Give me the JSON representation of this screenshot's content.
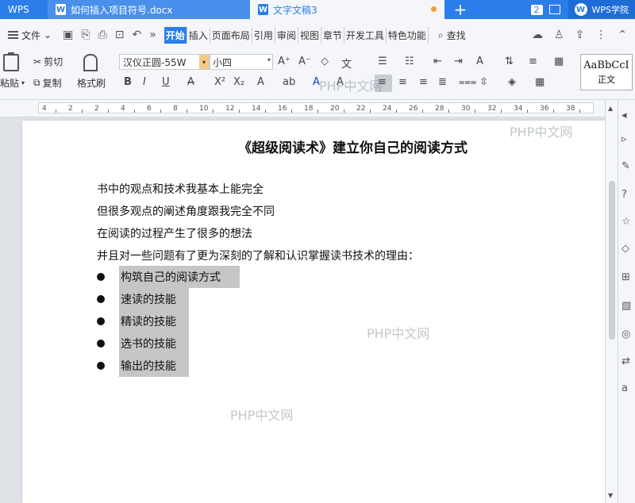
{
  "tabbar": {
    "app": "WPS",
    "tabs": [
      {
        "label": "如何插入项目符号.docx",
        "active": false
      },
      {
        "label": "文字文稿3",
        "active": true
      }
    ],
    "count": "2",
    "academy": "WPS学院"
  },
  "menubar": {
    "file": "文件",
    "tabs": [
      "开始",
      "插入",
      "页面布局",
      "引用",
      "审阅",
      "视图",
      "章节",
      "开发工具",
      "特色功能"
    ],
    "search": "查找"
  },
  "ribbon": {
    "paste": "粘贴",
    "cut": "剪切",
    "copy": "复制",
    "format_painter": "格式刷",
    "font": "汉仪正圆-55W",
    "size": "小四",
    "style_sample": "AaBbCcI",
    "style_name": "正文"
  },
  "ruler": {
    "ticks": [
      "4",
      "2",
      "2",
      "4",
      "6",
      "8",
      "10",
      "12",
      "14",
      "16",
      "18",
      "20",
      "22",
      "24",
      "26",
      "28",
      "30",
      "32",
      "34",
      "36",
      "38"
    ]
  },
  "document": {
    "title": "《超级阅读术》建立你自己的阅读方式",
    "paragraphs": [
      "书中的观点和技术我基本上能完全",
      "但很多观点的阐述角度跟我完全不同",
      "在阅读的过程产生了很多的想法",
      "并且对一些问题有了更为深刻的了解和认识掌握读书技术的理由："
    ],
    "bullets": [
      "构筑自己的阅读方式",
      "速读的技能",
      "精读的技能",
      "选书的技能",
      "输出的技能"
    ]
  },
  "watermarks": [
    "PHP中文网",
    "PHP中文网",
    "PHP中文网",
    "PHP中文网"
  ],
  "colors": {
    "accent": "#2b7de9",
    "selection": "#c6c6c6",
    "modified_dot": "#f29b3c"
  }
}
